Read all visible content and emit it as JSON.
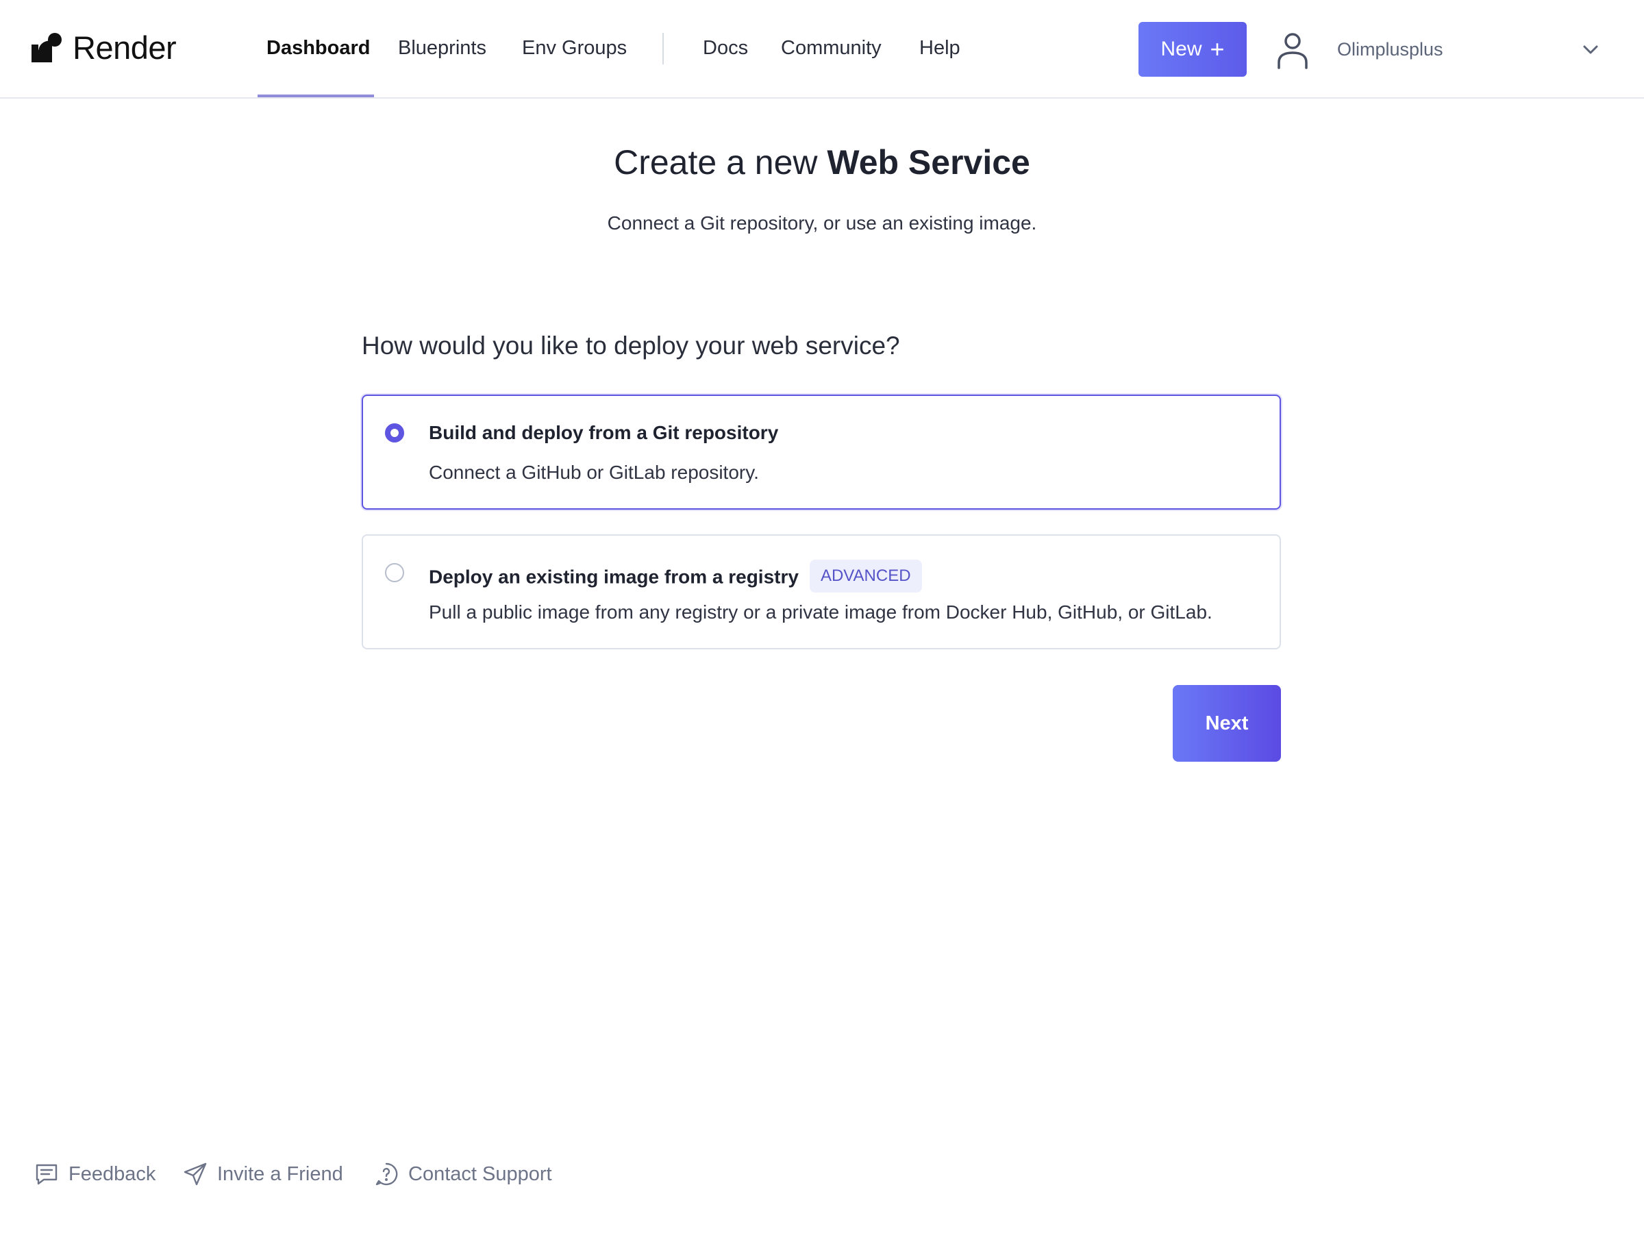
{
  "header": {
    "logo_text": "Render",
    "nav": [
      {
        "label": "Dashboard",
        "active": true
      },
      {
        "label": "Blueprints"
      },
      {
        "label": "Env Groups"
      },
      {
        "label": "Docs"
      },
      {
        "label": "Community"
      },
      {
        "label": "Help"
      }
    ],
    "new_button": {
      "label": "New",
      "icon": "plus-icon"
    },
    "user": {
      "name": "Olimplusplus",
      "avatar_icon": "user-icon",
      "menu_icon": "chevron-down-icon"
    }
  },
  "page": {
    "title_prefix": "Create a new",
    "title_emphasis": "Web Service",
    "subtitle": "Connect a Git repository, or use an existing image.",
    "question": "How would you like to deploy your web service?",
    "options": [
      {
        "title": "Build and deploy from a Git repository",
        "description": "Connect a GitHub or GitLab repository.",
        "selected": true
      },
      {
        "title": "Deploy an existing image from a registry",
        "badge": "ADVANCED",
        "description": "Pull a public image from any registry or a private image from Docker Hub, GitHub, or GitLab.",
        "selected": false
      }
    ],
    "next_label": "Next"
  },
  "footer": {
    "feedback": {
      "label": "Feedback",
      "icon": "feedback-icon"
    },
    "invite": {
      "label": "Invite a Friend",
      "icon": "send-icon"
    },
    "support": {
      "label": "Contact Support",
      "icon": "help-circle-icon"
    }
  },
  "colors": {
    "accent": "#5e55e0",
    "button_gradient_start": "#6a78f6",
    "button_gradient_end": "#5b4be3",
    "badge_bg": "#eeeffc",
    "badge_text": "#5553c8"
  }
}
